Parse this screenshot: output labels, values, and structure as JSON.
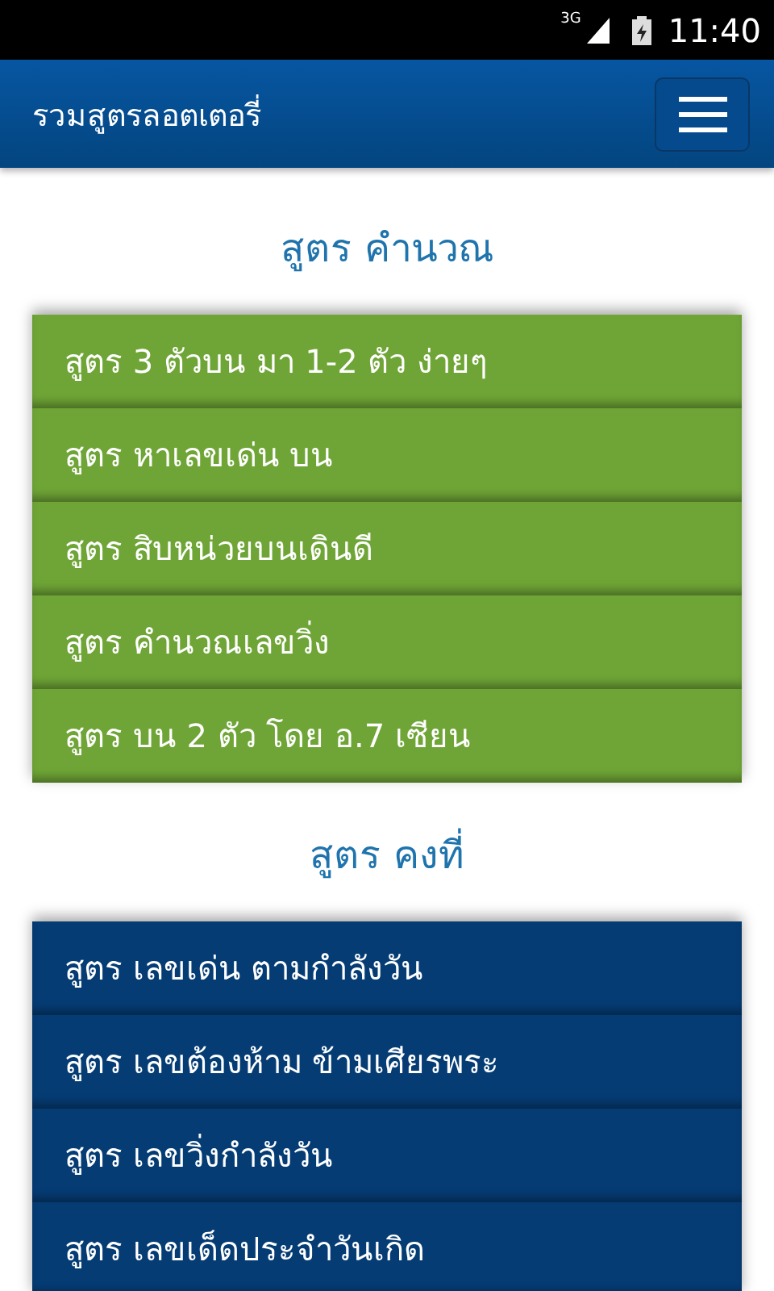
{
  "status_bar": {
    "network": "3G",
    "time": "11:40"
  },
  "header": {
    "title": "รวมสูตรลอตเตอรี่"
  },
  "sections": [
    {
      "title": "สูตร คำนวณ",
      "color": "#6fa536",
      "items": [
        "สูตร 3 ตัวบน มา 1-2 ตัว ง่ายๆ",
        "สูตร หาเลขเด่น บน",
        "สูตร สิบหน่วยบนเดินดี",
        "สูตร คำนวณเลขวิ่ง",
        "สูตร บน 2 ตัว โดย อ.7 เซียน"
      ]
    },
    {
      "title": "สูตร คงที่",
      "color": "#053c74",
      "items": [
        "สูตร เลขเด่น ตามกำลังวัน",
        "สูตร เลขต้องห้าม ข้ามเศียรพระ",
        "สูตร เลขวิ่งกำลังวัน",
        "สูตร เลขเด็ดประจำวันเกิด"
      ]
    }
  ]
}
